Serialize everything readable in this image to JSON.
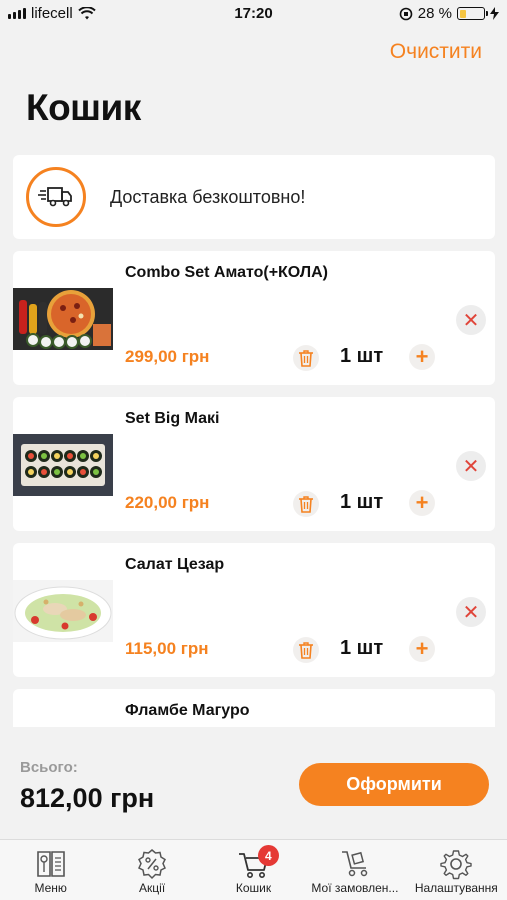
{
  "status_bar": {
    "carrier": "lifecell",
    "time": "17:20",
    "battery": "28 %",
    "battery_level": 0.28
  },
  "header": {
    "clear_label": "Очистити",
    "title": "Кошик"
  },
  "delivery": {
    "text": "Доставка безкоштовно!",
    "icon": "delivery-truck-icon"
  },
  "cart": {
    "items": [
      {
        "name": "Combo Set Амато(+КОЛА)",
        "price": "299,00 грн",
        "qty": "1 шт"
      },
      {
        "name": "Set Big Макі",
        "price": "220,00 грн",
        "qty": "1 шт"
      },
      {
        "name": "Салат Цезар",
        "price": "115,00 грн",
        "qty": "1 шт"
      },
      {
        "name": "Фламбе Магуро",
        "price": "",
        "qty": ""
      }
    ]
  },
  "summary": {
    "total_label": "Всього:",
    "total_value": "812,00 грн",
    "checkout_label": "Оформити"
  },
  "tabbar": {
    "tabs": [
      {
        "label": "Меню",
        "icon": "menu-book-icon"
      },
      {
        "label": "Акції",
        "icon": "discount-icon"
      },
      {
        "label": "Кошик",
        "icon": "cart-icon",
        "badge": "4"
      },
      {
        "label": "Мої замовлен...",
        "icon": "orders-icon"
      },
      {
        "label": "Налаштування",
        "icon": "gear-icon"
      }
    ]
  },
  "colors": {
    "accent": "#f58220",
    "remove": "#e0453a",
    "badge": "#e53935"
  }
}
